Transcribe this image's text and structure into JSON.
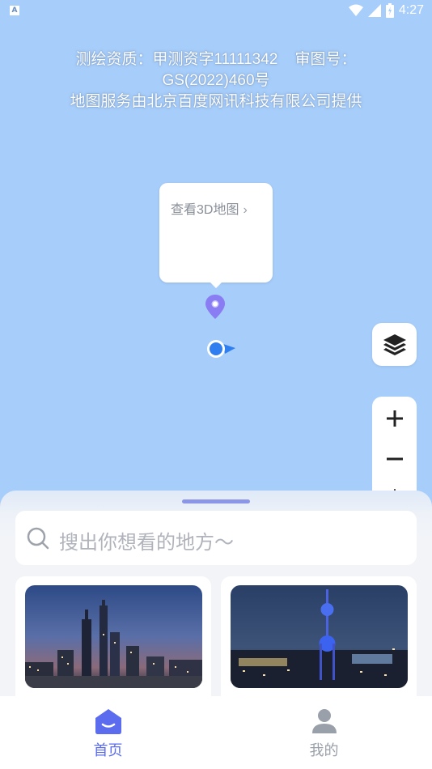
{
  "status_bar": {
    "notification_badge": "A",
    "time": "4:27"
  },
  "map": {
    "notice_line1": "测绘资质：甲测资字11111342    审图号：",
    "notice_line2": "GS(2022)460号",
    "notice_line3": "地图服务由北京百度网讯科技有限公司提供",
    "popup_link": "查看3D地图",
    "popup_chevron": "›",
    "pin_color": "#8a7cf3",
    "location_color": "#2f7ff0"
  },
  "controls": {
    "layers_icon": "layers-icon",
    "zoom_in_icon": "plus-icon",
    "zoom_out_icon": "minus-icon",
    "locate_icon": "locate-icon"
  },
  "search": {
    "placeholder": "搜出你想看的地方～"
  },
  "cards": [
    {
      "image": "shanghai-skyline-photo"
    },
    {
      "image": "oriental-pearl-tower-photo"
    }
  ],
  "tabbar": {
    "home_label": "首页",
    "mine_label": "我的",
    "active_color": "#5b6cee",
    "inactive_color": "#9aa0aa"
  }
}
